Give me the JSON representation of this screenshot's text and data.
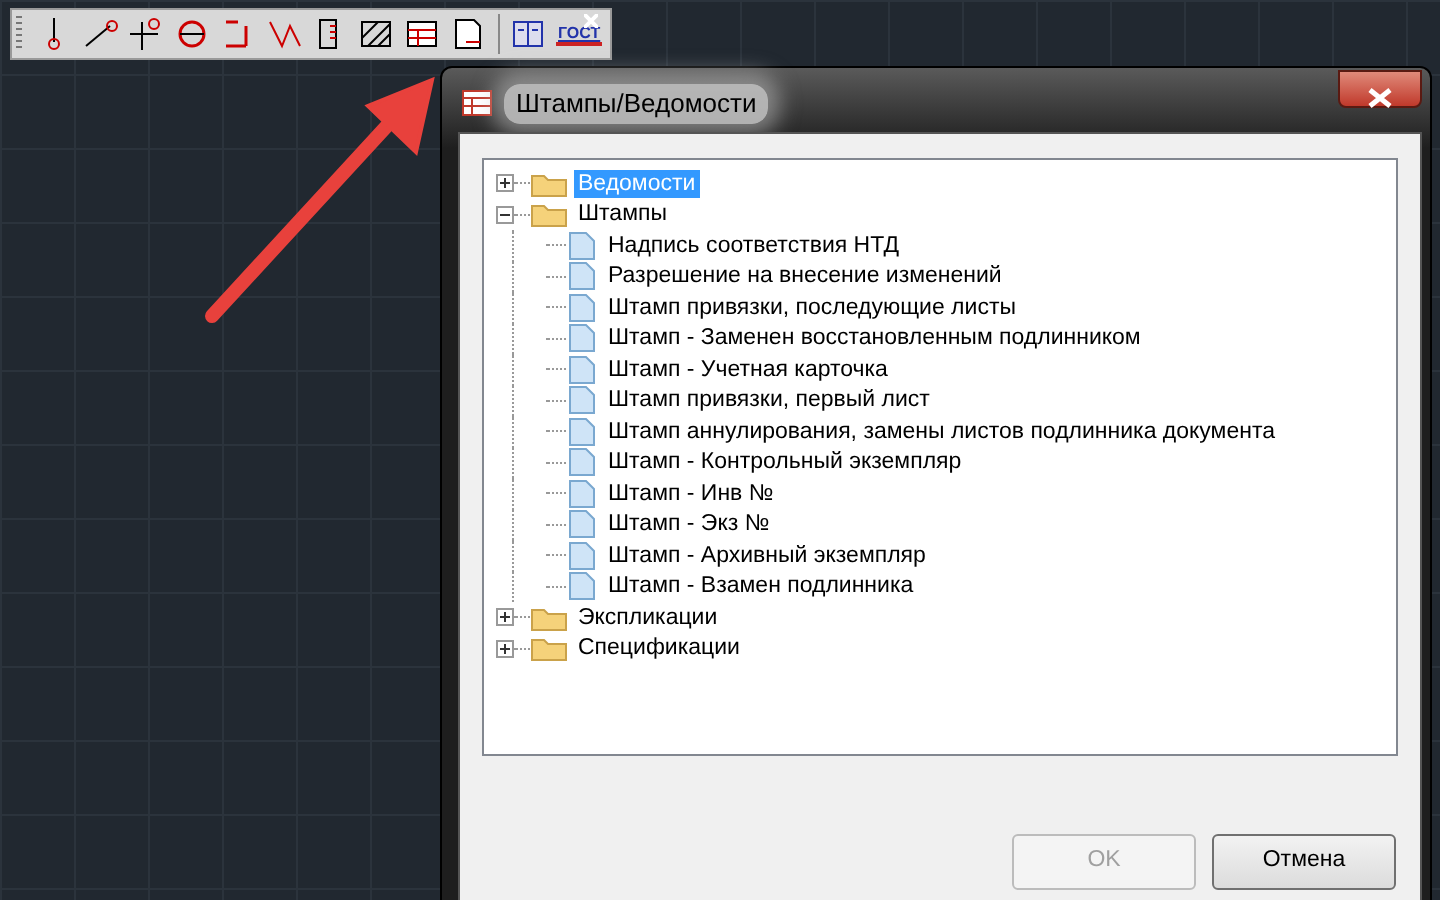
{
  "toolbar": {
    "gost_label": "ГОСТ"
  },
  "dialog": {
    "title": "Штампы/Ведомости",
    "tree": [
      {
        "label": "Ведомости",
        "kind": "folder",
        "expanded": false,
        "selected": true
      },
      {
        "label": "Штампы",
        "kind": "folder",
        "expanded": true,
        "selected": false,
        "children": [
          {
            "label": "Надпись соответствия НТД",
            "kind": "document",
            "selected": false
          },
          {
            "label": "Разрешение на внесение изменений",
            "kind": "document",
            "selected": false
          },
          {
            "label": "Штамп привязки, последующие листы",
            "kind": "document",
            "selected": false
          },
          {
            "label": "Штамп - Заменен восстановленным подлинником",
            "kind": "document",
            "selected": false
          },
          {
            "label": "Штамп - Учетная карточка",
            "kind": "document",
            "selected": false
          },
          {
            "label": "Штамп привязки, первый лист",
            "kind": "document",
            "selected": false
          },
          {
            "label": "Штамп аннулирования, замены листов подлинника документа",
            "kind": "document",
            "selected": false
          },
          {
            "label": "Штамп - Контрольный экземпляр",
            "kind": "document",
            "selected": false
          },
          {
            "label": "Штамп - Инв №",
            "kind": "document",
            "selected": false
          },
          {
            "label": "Штамп - Экз №",
            "kind": "document",
            "selected": false
          },
          {
            "label": "Штамп - Архивный экземпляр",
            "kind": "document",
            "selected": false
          },
          {
            "label": "Штамп - Взамен подлинника",
            "kind": "document",
            "selected": false
          }
        ]
      },
      {
        "label": "Экспликации",
        "kind": "folder",
        "expanded": false,
        "selected": false
      },
      {
        "label": "Спецификации",
        "kind": "folder",
        "expanded": false,
        "selected": false
      }
    ],
    "ok_button": {
      "label": "OK",
      "disabled": true
    },
    "cancel_button": {
      "label": "Отмена"
    }
  }
}
